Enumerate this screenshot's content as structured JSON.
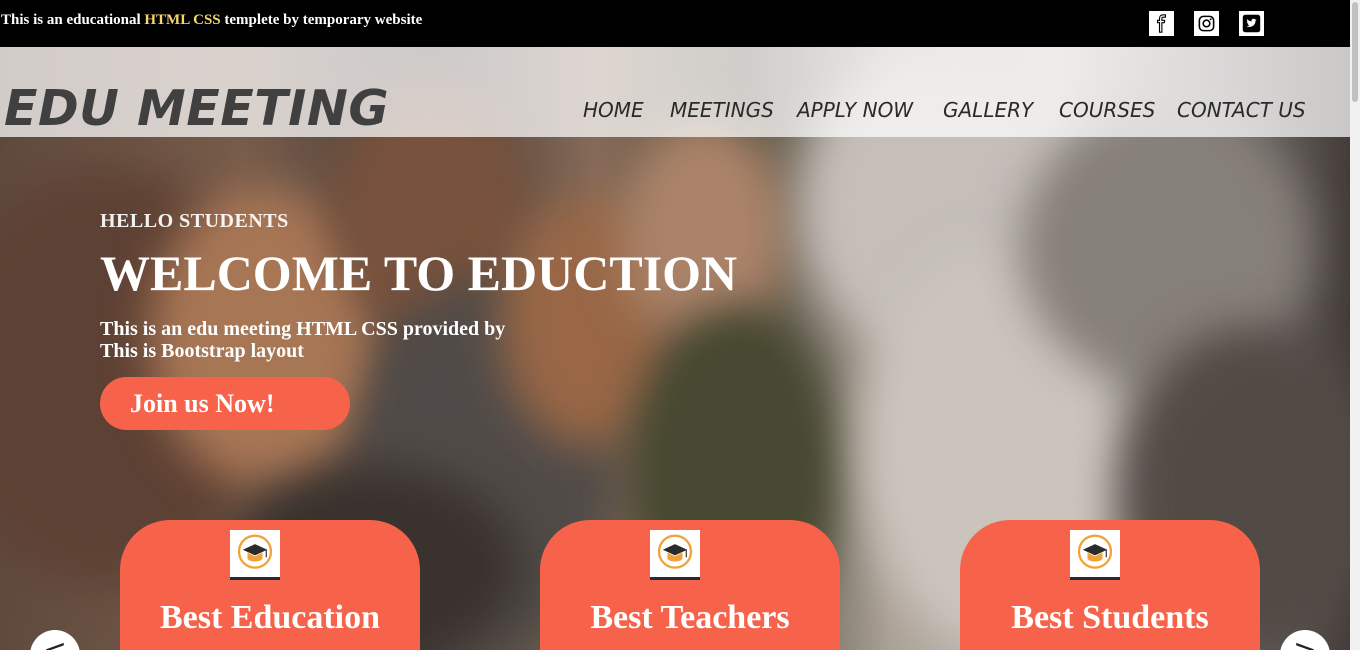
{
  "topbar": {
    "text_before": "This is an educational ",
    "text_highlight": "HTML CSS",
    "text_after": " templete by temporary website",
    "social": [
      {
        "icon": "facebook-icon"
      },
      {
        "icon": "instagram-icon"
      },
      {
        "icon": "twitter-icon"
      }
    ]
  },
  "nav": {
    "brand": "EDU MEETING",
    "items": [
      "HOME",
      "MEETINGS",
      "APPLY NOW",
      "GALLERY",
      "COURSES",
      "CONTACT US"
    ]
  },
  "hero": {
    "hello": "HELLO STUDENTS",
    "welcome": "WELCOME TO EDUCTION",
    "desc_line1": "This is an edu meeting HTML CSS provided by",
    "desc_line2": "This is Bootstrap layout",
    "join_button": "Join us Now!"
  },
  "cards": [
    {
      "icon": "graduation-cap-icon",
      "title": "Best Education"
    },
    {
      "icon": "graduation-cap-icon",
      "title": "Best Teachers"
    },
    {
      "icon": "graduation-cap-icon",
      "title": "Best Students"
    }
  ],
  "slider": {
    "prev": "<",
    "next": ">"
  },
  "colors": {
    "accent": "#f7634a",
    "topbar_bg": "#000000",
    "highlight": "#f5d76e"
  }
}
